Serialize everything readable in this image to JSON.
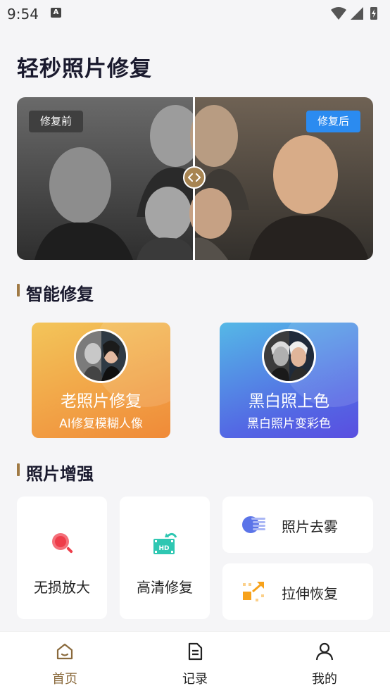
{
  "status_bar": {
    "time": "9:54",
    "notification_icon": "A"
  },
  "page": {
    "title": "轻秒照片修复"
  },
  "compare": {
    "before_label": "修复前",
    "after_label": "修复后"
  },
  "smart_repair": {
    "title": "智能修复",
    "cards": [
      {
        "title": "老照片修复",
        "subtitle": "AI修复模糊人像"
      },
      {
        "title": "黑白照上色",
        "subtitle": "黑白照片变彩色"
      }
    ]
  },
  "enhance": {
    "title": "照片增强",
    "tiles": [
      {
        "label": "无损放大",
        "icon": "zoom-icon"
      },
      {
        "label": "高清修复",
        "icon": "hd-film-icon"
      },
      {
        "label": "照片去雾",
        "icon": "haze-cloud-icon"
      },
      {
        "label": "拉伸恢复",
        "icon": "stretch-arrow-icon"
      }
    ]
  },
  "bottom_nav": {
    "items": [
      {
        "label": "首页",
        "icon": "home-icon"
      },
      {
        "label": "记录",
        "icon": "document-icon"
      },
      {
        "label": "我的",
        "icon": "user-icon"
      }
    ],
    "active_index": 0
  },
  "colors": {
    "accent_brown": "#8a6a3c",
    "after_badge_blue": "#2b8bf0",
    "old_card_gradient": [
      "#f3c55a",
      "#f08a38"
    ],
    "color_card_gradient": [
      "#55b8e6",
      "#5a4ee0"
    ]
  }
}
